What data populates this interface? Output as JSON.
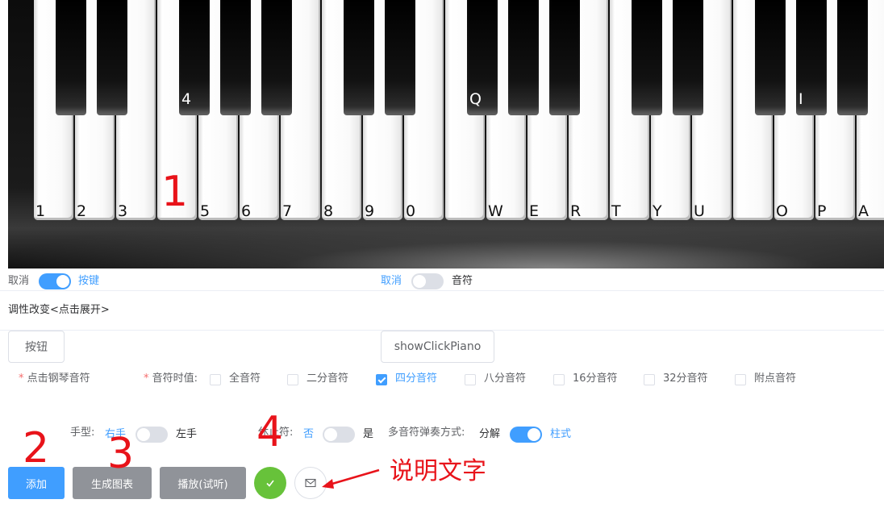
{
  "piano": {
    "white_keys": [
      "1",
      "2",
      "3",
      "",
      "5",
      "6",
      "7",
      "8",
      "9",
      "0",
      "",
      "W",
      "E",
      "R",
      "T",
      "Y",
      "U",
      "",
      "O",
      "P",
      "A"
    ],
    "black_keys": [
      "",
      "",
      "4",
      "",
      "",
      "",
      "",
      "Q",
      "",
      "",
      "",
      "",
      "",
      "I",
      "",
      ""
    ]
  },
  "annotations": {
    "n1": "1",
    "n2": "2",
    "n3": "3",
    "n4": "4",
    "caption": "说明文字"
  },
  "row1": {
    "cancel_left": "取消",
    "keys_label": "按键",
    "cancel_right": "取消",
    "notes_label": "音符"
  },
  "tonality": "调性改变<点击展开>",
  "buttons_row": {
    "button_label": "按钮",
    "show_piano_label": "showClickPiano"
  },
  "note_form": {
    "click_piano_label": "点击钢琴音符",
    "duration_label": "音符时值:",
    "durations": [
      "全音符",
      "二分音符",
      "四分音符",
      "八分音符",
      "16分音符",
      "32分音符",
      "附点音符"
    ],
    "selected_duration": "四分音符"
  },
  "options": {
    "hand_label": "手型:",
    "hand_right": "右手",
    "hand_left": "左手",
    "rest_label": "休止符:",
    "rest_no": "否",
    "rest_yes": "是",
    "multi_label": "多音符弹奏方式:",
    "multi_split": "分解",
    "multi_chord": "柱式"
  },
  "actions": {
    "add": "添加",
    "chart": "生成图表",
    "play": "播放(试听)"
  },
  "colors": {
    "primary": "#409eff",
    "success": "#67c23a",
    "gray": "#909399",
    "annotation": "#e8131a"
  }
}
